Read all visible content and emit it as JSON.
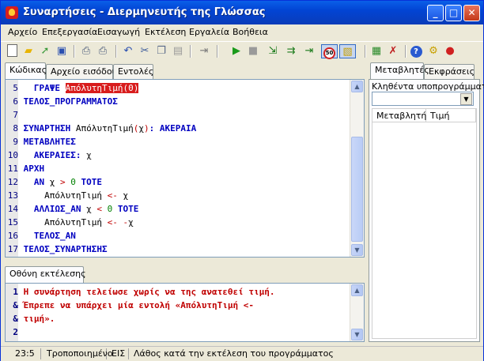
{
  "window": {
    "title": "Συναρτήσεις - Διερμηνευτής της Γλώσσας"
  },
  "menu": [
    "Αρχείο",
    "Επεξεργασία",
    "Εισαγωγή",
    "Εκτέλεση",
    "Εργαλεία",
    "Βοήθεια"
  ],
  "toolbar": {
    "speed_label": "50"
  },
  "left_tabs": [
    "Κώδικας",
    "Αρχείο εισόδου",
    "Εντολές"
  ],
  "code_lines": [
    {
      "n": "5",
      "tokens": [
        [
          "kw",
          "  ΓΡΑΨΕ "
        ],
        [
          "hl",
          "ΑπόλυτηΤιμή(0)"
        ]
      ]
    },
    {
      "n": "6",
      "tokens": [
        [
          "kw",
          "ΤΕΛΟΣ_ΠΡΟΓΡΑΜΜΑΤΟΣ"
        ]
      ]
    },
    {
      "n": "7",
      "tokens": []
    },
    {
      "n": "8",
      "tokens": [
        [
          "kw",
          "ΣΥΝΑΡΤΗΣΗ "
        ],
        [
          "id",
          "ΑπόλυτηΤιμή"
        ],
        [
          "op",
          "("
        ],
        [
          "id",
          "χ"
        ],
        [
          "op",
          ")"
        ],
        [
          "kw",
          ": ΑΚΕΡΑΙΑ"
        ]
      ]
    },
    {
      "n": "9",
      "tokens": [
        [
          "kw",
          "ΜΕΤΑΒΛΗΤΕΣ"
        ]
      ]
    },
    {
      "n": "10",
      "tokens": [
        [
          "kw",
          "  ΑΚΕΡΑΙΕΣ: "
        ],
        [
          "id",
          "χ"
        ]
      ]
    },
    {
      "n": "11",
      "tokens": [
        [
          "kw",
          "ΑΡΧΗ"
        ]
      ]
    },
    {
      "n": "12",
      "tokens": [
        [
          "kw",
          "  ΑΝ "
        ],
        [
          "id",
          "χ "
        ],
        [
          "op",
          "> "
        ],
        [
          "num",
          "0"
        ],
        [
          "kw",
          " ΤΟΤΕ"
        ]
      ]
    },
    {
      "n": "13",
      "tokens": [
        [
          "id",
          "    ΑπόλυτηΤιμή "
        ],
        [
          "op",
          "<- "
        ],
        [
          "id",
          "χ"
        ]
      ]
    },
    {
      "n": "14",
      "tokens": [
        [
          "kw",
          "  ΑΛΛΙΩΣ_ΑΝ "
        ],
        [
          "id",
          "χ "
        ],
        [
          "op",
          "< "
        ],
        [
          "num",
          "0"
        ],
        [
          "kw",
          " ΤΟΤΕ"
        ]
      ]
    },
    {
      "n": "15",
      "tokens": [
        [
          "id",
          "    ΑπόλυτηΤιμή "
        ],
        [
          "op",
          "<- -"
        ],
        [
          "id",
          "χ"
        ]
      ]
    },
    {
      "n": "16",
      "tokens": [
        [
          "kw",
          "  ΤΕΛΟΣ_ΑΝ"
        ]
      ]
    },
    {
      "n": "17",
      "tokens": [
        [
          "kw",
          "ΤΕΛΟΣ_ΣΥΝΑΡΤΗΣΗΣ"
        ]
      ]
    }
  ],
  "output_tab": "Οθόνη εκτέλεσης",
  "output_lines": [
    {
      "n": "1",
      "text": "Η συνάρτηση τελείωσε χωρίς να της ανατεθεί τιμή."
    },
    {
      "n": "&",
      "text": "Έπρεπε να υπάρχει μία εντολή «ΑπόλυτηΤιμή <-"
    },
    {
      "n": "&",
      "text": "τιμή»."
    },
    {
      "n": "2",
      "text": ""
    }
  ],
  "right_tabs": [
    "Μεταβλητές",
    "Εκφράσεις"
  ],
  "called_label": "Κληθέντα υποπρογράμματα:",
  "called_value": "",
  "grid_headers": [
    "Μεταβλητή",
    "Τιμή"
  ],
  "status": {
    "position": "23:5",
    "modified": "Τροποποιημένο",
    "mode": "ΕΙΣ",
    "message": "Λάθος κατά την εκτέλεση του προγράμματος"
  }
}
